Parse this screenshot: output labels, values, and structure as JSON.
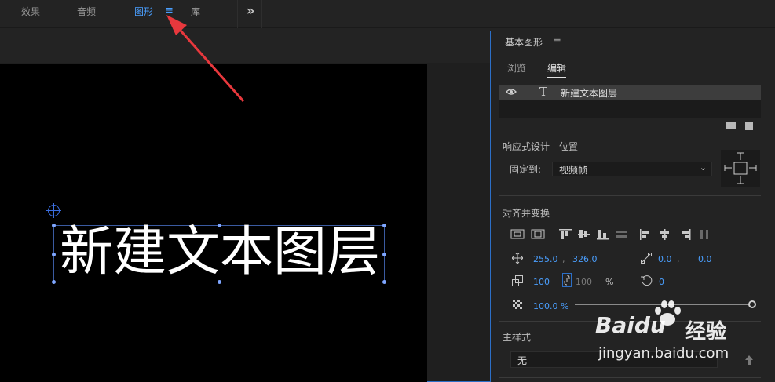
{
  "workspace_tabs": [
    {
      "label": "效果",
      "active": false
    },
    {
      "label": "音频",
      "active": false
    },
    {
      "label": "图形",
      "active": true
    },
    {
      "label": "库",
      "active": false
    }
  ],
  "workspace_menu_glyph": "≡",
  "workspace_more_glyph": "»",
  "monitor": {
    "text_layer_content": "新建文本图层"
  },
  "panel": {
    "title": "基本图形",
    "menu_glyph": "≡",
    "tabs": [
      {
        "label": "浏览",
        "active": false
      },
      {
        "label": "编辑",
        "active": true
      }
    ],
    "layers": [
      {
        "type_glyph": "T",
        "name": "新建文本图层",
        "visible": true
      }
    ],
    "responsive": {
      "section_title": "响应式设计 - 位置",
      "pin_label": "固定到:",
      "pin_value": "视频帧"
    },
    "align": {
      "section_title": "对齐并变换",
      "position_x": "255.0",
      "position_y": "326.0",
      "anchor_x": "0.0",
      "anchor_y": "0.0",
      "scale": "100",
      "scale_linked": "100",
      "scale_unit": "%",
      "rotation": "0",
      "opacity": "100.0 %",
      "opacity_fraction": 1.0
    },
    "master_style": {
      "section_title": "主样式",
      "value": "无"
    }
  },
  "watermark": {
    "brand": "Baidu",
    "cn": "经验",
    "url": "jingyan.baidu.com"
  },
  "colors": {
    "accent": "#4a9fff",
    "arrow": "#e8383d"
  }
}
